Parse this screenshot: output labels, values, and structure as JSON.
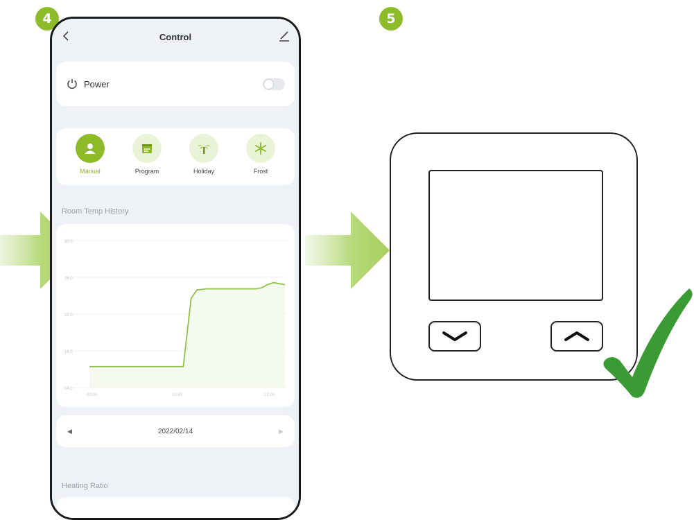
{
  "steps": {
    "left": "4",
    "right": "5"
  },
  "phone": {
    "header": {
      "title": "Control"
    },
    "power": {
      "label": "Power",
      "on": false
    },
    "modes": [
      {
        "label": "Manual",
        "active": true,
        "icon": "person-icon"
      },
      {
        "label": "Program",
        "active": false,
        "icon": "calendar-icon"
      },
      {
        "label": "Holiday",
        "active": false,
        "icon": "palm-tree-icon"
      },
      {
        "label": "Frost",
        "active": false,
        "icon": "snowflake-icon"
      }
    ],
    "history_title": "Room Temp History",
    "date": {
      "value": "2022/02/14",
      "prev": "◀",
      "next": "▶"
    },
    "ratio_title": "Heating Ratio"
  },
  "chart_data": {
    "type": "line",
    "title": "Room Temp History",
    "ylim": [
      16.0,
      30.0
    ],
    "yticks": [
      "30.0",
      "26.0",
      "22.0",
      "18.0",
      "14.0"
    ],
    "xticks": [
      "00:00",
      "10:40",
      "13:00"
    ],
    "series": [
      {
        "x": [
          0,
          0.45,
          0.48,
          0.52,
          0.55,
          0.6,
          0.7,
          0.85,
          0.88,
          0.91,
          0.94,
          1.0
        ],
        "values": [
          18.0,
          18.0,
          18.0,
          24.5,
          25.3,
          25.4,
          25.4,
          25.4,
          25.5,
          25.8,
          26.0,
          25.8
        ]
      }
    ],
    "grid": true
  },
  "colors": {
    "accent": "#8dbb2a",
    "line": "#92c14a",
    "background": "#eef1f5"
  }
}
